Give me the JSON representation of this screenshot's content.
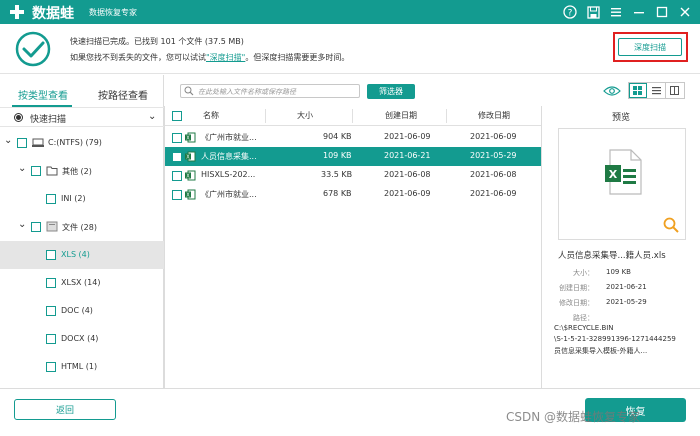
{
  "app": {
    "name": "数据蛙",
    "subtitle": "数据恢复专家"
  },
  "status": {
    "line1": "快速扫描已完成。已找到 101 个文件 (37.5 MB)",
    "line2_prefix": "如果您找不到丢失的文件，您可以试试",
    "line2_link": "\"深度扫描\"",
    "line2_suffix": "。但深度扫描需要更多时间。",
    "deep_scan_label": "深度扫描"
  },
  "left": {
    "tab_type": "按类型查看",
    "tab_path": "按路径查看",
    "quick_scan": "快速扫描",
    "tree": [
      {
        "label": "C:(NTFS) (79)"
      },
      {
        "label": "其他 (2)"
      },
      {
        "label": "INI (2)"
      },
      {
        "label": "文件 (28)"
      },
      {
        "label": "XLS (4)"
      },
      {
        "label": "XLSX (14)"
      },
      {
        "label": "DOC (4)"
      },
      {
        "label": "DOCX (4)"
      },
      {
        "label": "HTML (1)"
      }
    ]
  },
  "toolbar": {
    "search_placeholder": "在此处输入文件名称或保存路径",
    "filter_label": "筛选器"
  },
  "table": {
    "headers": {
      "name": "名称",
      "size": "大小",
      "created": "创建日期",
      "modified": "修改日期"
    },
    "rows": [
      {
        "name": "《广州市就业...",
        "size": "904 KB",
        "created": "2021-06-09",
        "modified": "2021-06-09"
      },
      {
        "name": "人员信息采集...",
        "size": "109 KB",
        "created": "2021-06-21",
        "modified": "2021-05-29"
      },
      {
        "name": "HISXLS-202...",
        "size": "33.5 KB",
        "created": "2021-06-08",
        "modified": "2021-06-08"
      },
      {
        "name": "《广州市就业...",
        "size": "678 KB",
        "created": "2021-06-09",
        "modified": "2021-06-09"
      }
    ]
  },
  "preview": {
    "title": "预览",
    "file_name": "人员信息采集导...籍人员.xls",
    "size_label": "大小：",
    "size": "109 KB",
    "created_label": "创建日期：",
    "created": "2021-06-21",
    "modified_label": "修改日期：",
    "modified": "2021-05-29",
    "path_label": "路径：",
    "path_line1": "C:\\$RECYCLE.BIN",
    "path_line2": "\\S-1-5-21-328991396-1271444259",
    "path_line3": "员信息采集导入模板-外籍人..."
  },
  "bottom": {
    "back_label": "返回",
    "recover_label": "恢复",
    "watermark": "CSDN @数据蛙恢复专家"
  },
  "colors": {
    "accent": "#139b90",
    "highlight": "#e02020"
  }
}
